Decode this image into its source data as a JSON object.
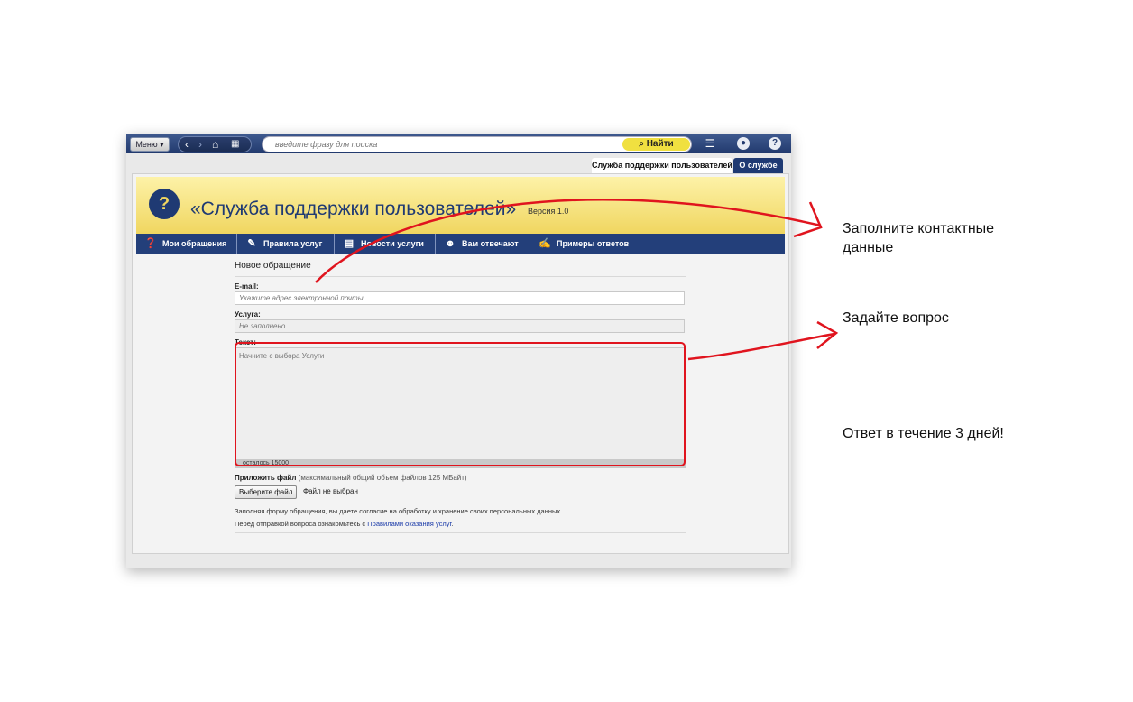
{
  "toolbar": {
    "menu_label": "Меню ▾",
    "search_placeholder": "введите фразу для поиска",
    "search_button": "Найти"
  },
  "tabs": [
    {
      "label": "Служба поддержки пользователей",
      "active": true
    },
    {
      "label": "О службе",
      "active": false
    }
  ],
  "banner": {
    "title": "«Служба поддержки пользователей»",
    "version": "Версия 1.0"
  },
  "nav": [
    {
      "label": "Мои обращения",
      "icon": "question-icon"
    },
    {
      "label": "Правила услуг",
      "icon": "pin-icon"
    },
    {
      "label": "Новости услуги",
      "icon": "newspaper-icon"
    },
    {
      "label": "Вам отвечают",
      "icon": "users-icon"
    },
    {
      "label": "Примеры ответов",
      "icon": "edit-icon"
    }
  ],
  "form": {
    "heading": "Новое обращение",
    "email_label": "E-mail:",
    "email_placeholder": "Укажите адрес электронной почты",
    "service_label": "Услуга:",
    "service_value": "Не заполнено",
    "text_label": "Текст:",
    "text_placeholder": "Начните с выбора Услуги",
    "counter": "осталось 15000",
    "attach_label": "Приложить файл",
    "attach_note": "(максимальный общий объем файлов 125 МБайт)",
    "file_button": "Выберите файл",
    "file_status": "Файл не выбран",
    "consent_line1": "Заполняя форму обращения, вы даете согласие на обработку и хранение своих персональных данных.",
    "consent_line2_prefix": "Перед отправкой вопроса ознакомьтесь с ",
    "consent_link": "Правилами оказания услуг",
    "consent_line2_suffix": "."
  },
  "annotations": {
    "contact": "Заполните контактные данные",
    "question": "Задайте вопрос",
    "answer": "Ответ в течение 3 дней!"
  },
  "colors": {
    "highlight": "#e0141e",
    "navbar": "#233f7a",
    "banner": "#f0d660"
  }
}
